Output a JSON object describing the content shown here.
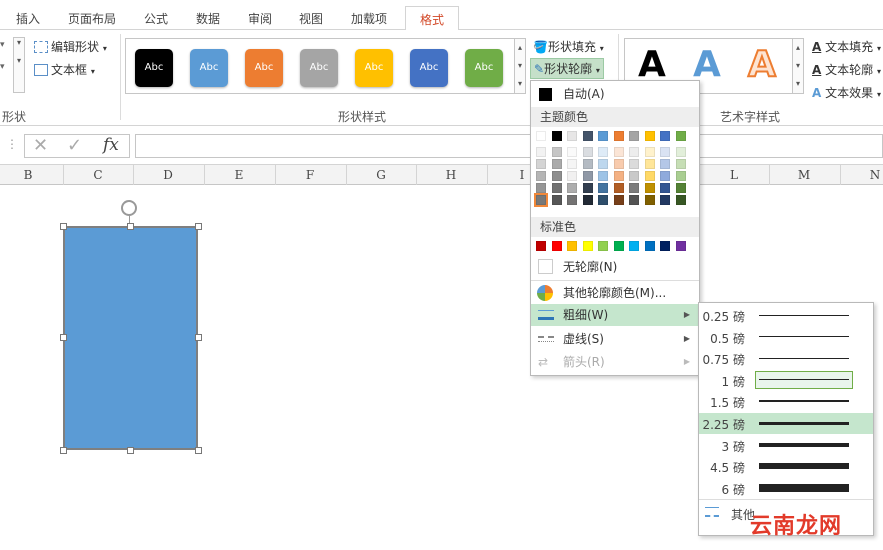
{
  "tabs": [
    "插入",
    "页面布局",
    "公式",
    "数据",
    "审阅",
    "视图",
    "加载项",
    "格式"
  ],
  "active_tab": "格式",
  "ribbon": {
    "insert_shapes": {
      "edit_shape_label": "编辑形状",
      "textbox_label": "文本框",
      "group_label": "形状"
    },
    "shape_styles": {
      "group_label": "形状样式",
      "swatch_text": "Abc",
      "swatch_colors": [
        "#000000",
        "#5b9bd5",
        "#ed7d31",
        "#a5a5a5",
        "#ffc000",
        "#4472c4",
        "#70ad47"
      ],
      "shape_fill_label": "形状填充",
      "shape_outline_label": "形状轮廓"
    },
    "wordart": {
      "group_label": "艺术字样式",
      "letter": "A",
      "text_fill_label": "文本填充",
      "text_outline_label": "文本轮廓",
      "text_effects_label": "文本效果"
    }
  },
  "formula_bar": {
    "cancel_glyph": "✕",
    "enter_glyph": "✓",
    "fx_label": "fx",
    "value": ""
  },
  "columns": [
    "B",
    "C",
    "D",
    "E",
    "F",
    "G",
    "H",
    "I",
    "L",
    "M",
    "N"
  ],
  "outline_menu": {
    "auto_label": "自动(A)",
    "theme_colors_label": "主题颜色",
    "theme_top_row": [
      "#ffffff",
      "#000000",
      "#e7e6e6",
      "#44546a",
      "#5b9bd5",
      "#ed7d31",
      "#a5a5a5",
      "#ffc000",
      "#4472c4",
      "#70ad47"
    ],
    "standard_colors_label": "标准色",
    "standard_colors": [
      "#c00000",
      "#ff0000",
      "#ffc000",
      "#ffff00",
      "#92d050",
      "#00b050",
      "#00b0f0",
      "#0070c0",
      "#002060",
      "#7030a0"
    ],
    "no_outline_label": "无轮廓(N)",
    "more_colors_label": "其他轮廓颜色(M)...",
    "weight_label": "粗细(W)",
    "dashes_label": "虚线(S)",
    "arrows_label": "箭头(R)"
  },
  "weight_menu": {
    "items": [
      "0.25 磅",
      "0.5 磅",
      "0.75 磅",
      "1 磅",
      "1.5 磅",
      "2.25 磅",
      "3 磅",
      "4.5 磅",
      "6 磅"
    ],
    "selected": "1 磅",
    "hovered": "2.25 磅",
    "more_lines_label": "其他"
  },
  "watermark": "云南龙网"
}
